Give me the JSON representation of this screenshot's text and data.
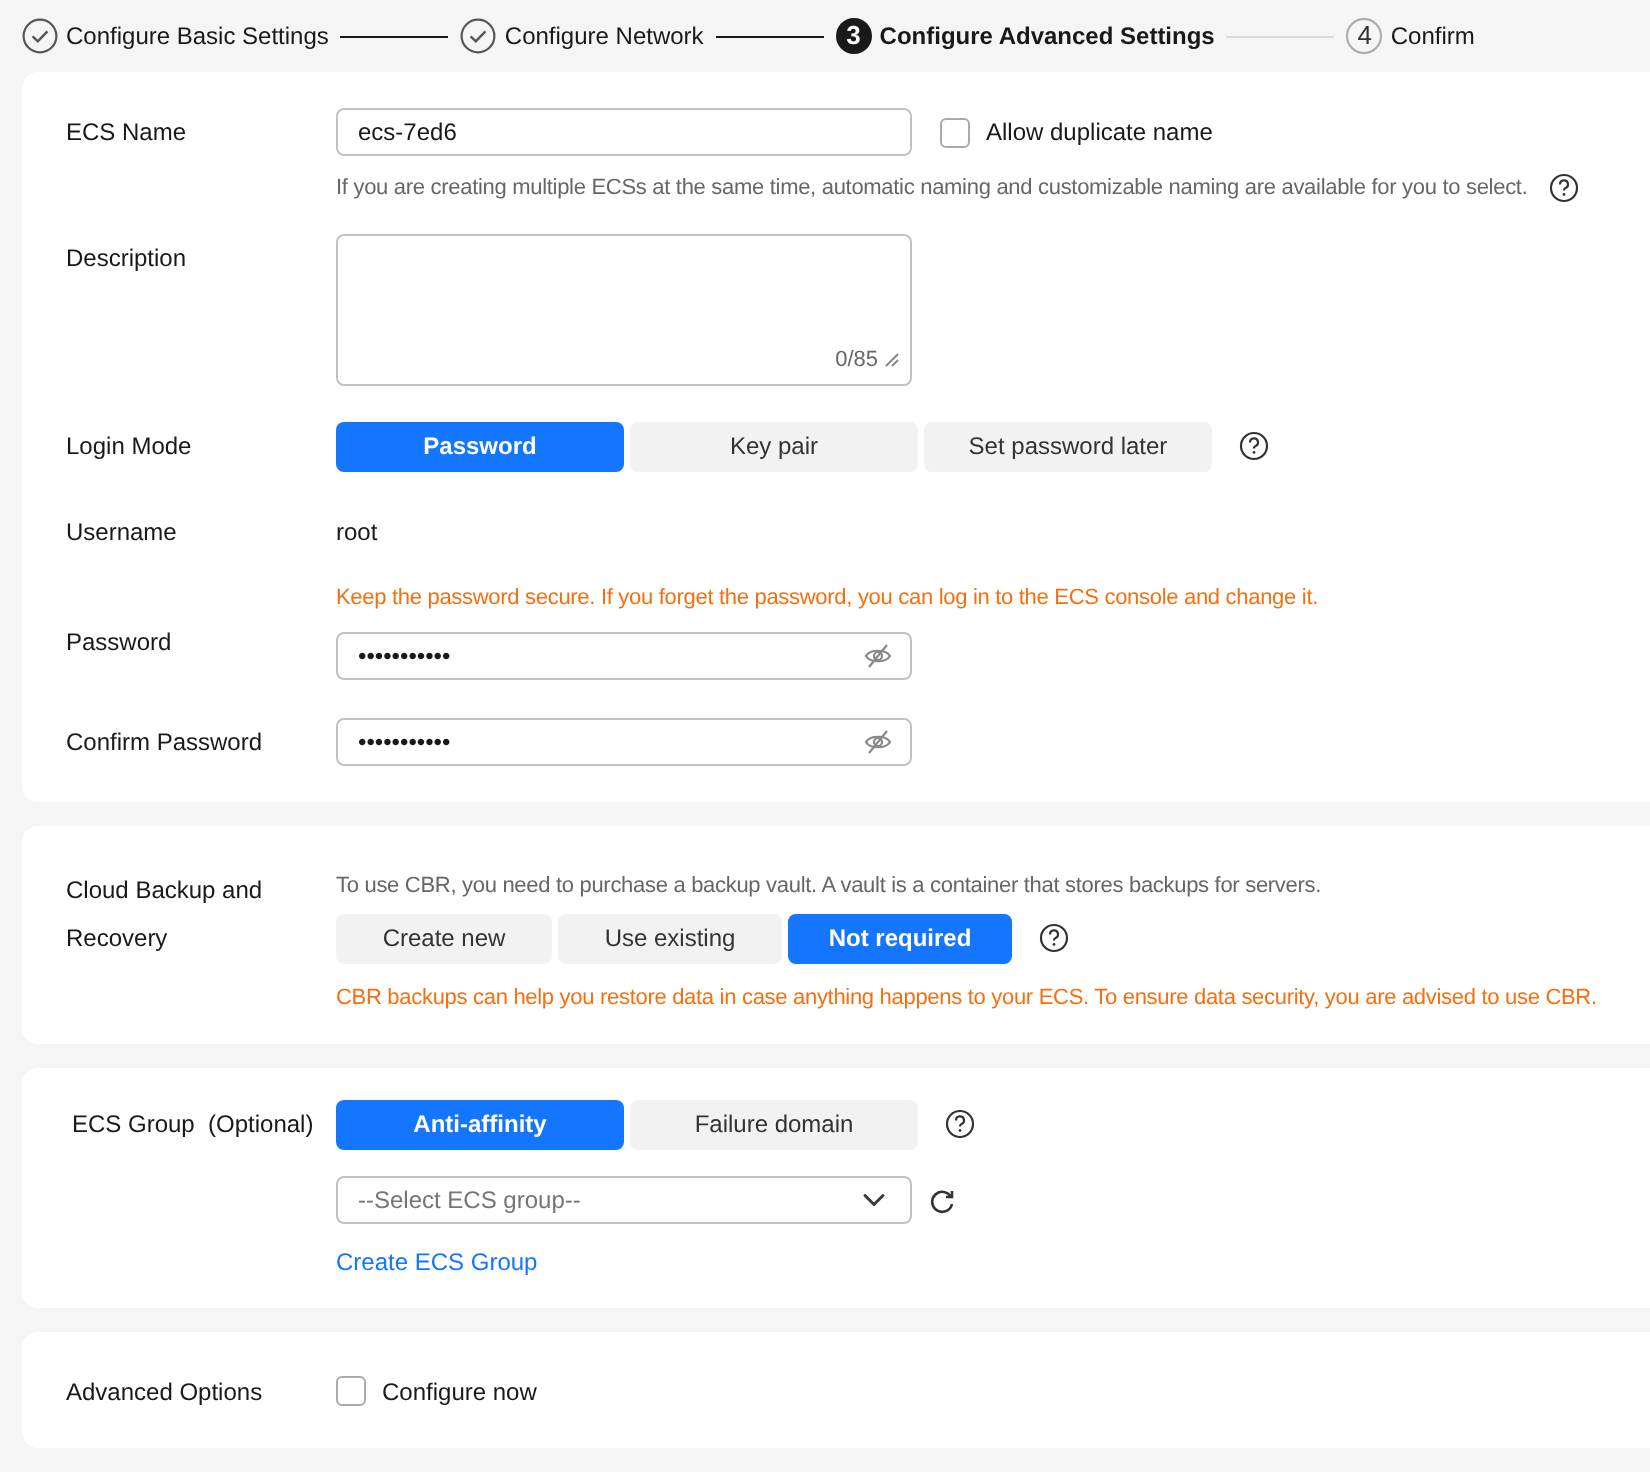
{
  "steps": [
    {
      "kind": "done",
      "label": "Configure Basic Settings"
    },
    {
      "kind": "done",
      "label": "Configure Network"
    },
    {
      "kind": "current",
      "number": "3",
      "label": "Configure Advanced Settings"
    },
    {
      "kind": "pending",
      "number": "4",
      "label": "Confirm"
    }
  ],
  "basic": {
    "ecs_name": {
      "label": "ECS Name",
      "value": "ecs-7ed6",
      "checkbox": {
        "label": "Allow duplicate name",
        "checked": false
      },
      "hint": "If you are creating multiple ECSs at the same time, automatic naming and customizable naming are available for you to select."
    },
    "description": {
      "label": "Description",
      "counter": "0/85"
    },
    "login_mode": {
      "label": "Login Mode",
      "options": [
        {
          "label": "Password",
          "selected": true
        },
        {
          "label": "Key pair",
          "selected": false
        },
        {
          "label": "Set password later",
          "selected": false
        }
      ]
    },
    "username": {
      "label": "Username",
      "value": "root"
    },
    "password": {
      "label": "Password",
      "warning": "Keep the password secure. If you forget the password, you can log in to the ECS console and change it.",
      "value": "•••••••••••"
    },
    "confirm_password": {
      "label": "Confirm Password",
      "value": "•••••••••••"
    }
  },
  "backup": {
    "label": "Cloud Backup and Recovery",
    "note": "To use CBR, you need to purchase a backup vault. A vault is a container that stores backups for servers.",
    "options": [
      {
        "label": "Create new",
        "selected": false
      },
      {
        "label": "Use existing",
        "selected": false
      },
      {
        "label": "Not required",
        "selected": true
      }
    ],
    "warning": "CBR backups can help you restore data in case anything happens to your ECS. To ensure data security, you are advised to use CBR."
  },
  "ecs_group": {
    "label": "ECS Group  (Optional)",
    "options": [
      {
        "label": "Anti-affinity",
        "selected": true
      },
      {
        "label": "Failure domain",
        "selected": false
      }
    ],
    "select": {
      "placeholder": "--Select ECS group--"
    },
    "link": "Create ECS Group"
  },
  "advanced": {
    "label": "Advanced Options",
    "checkbox": {
      "label": "Configure now",
      "checked": false
    }
  }
}
